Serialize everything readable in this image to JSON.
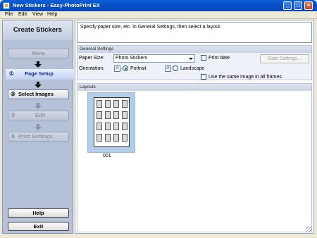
{
  "window": {
    "title": "New Stickers - Easy-PhotoPrint EX",
    "minimize": "_",
    "maximize": "□",
    "close": "×"
  },
  "menubar": {
    "file": "File",
    "edit": "Edit",
    "view": "View",
    "help": "Help"
  },
  "sidebar": {
    "header": "Create Stickers",
    "menu": "Menu",
    "steps": [
      {
        "num": "①",
        "label": "Page Setup"
      },
      {
        "num": "②",
        "label": "Select Images"
      },
      {
        "num": "③",
        "label": "Edit"
      },
      {
        "num": "④",
        "label": "Print Settings"
      }
    ],
    "help": "Help",
    "exit": "Exit"
  },
  "instructions": "Specify paper size, etc. in General Settings, then select a layout.",
  "general_settings": {
    "title": "General Settings",
    "paper_size_label": "Paper Size:",
    "paper_size_value": "Photo Stickers",
    "print_date": "Print date",
    "date_settings": "Date Settings...",
    "orientation_label": "Orientation:",
    "portrait": "Portrait",
    "landscape": "Landscape",
    "orientation_icon_letter": "A",
    "same_image": "Use the same image in all frames"
  },
  "layouts": {
    "title": "Layouts",
    "items": [
      {
        "caption": "001"
      }
    ]
  }
}
